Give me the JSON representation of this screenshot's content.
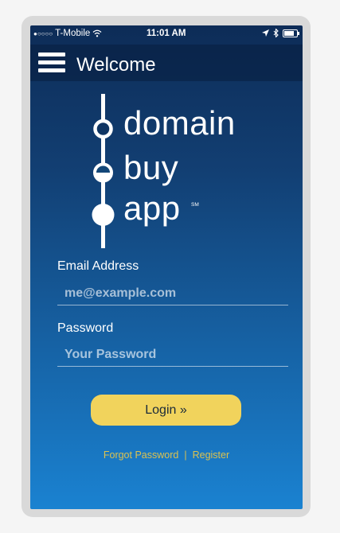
{
  "statusbar": {
    "signal_dots": "●○○○○",
    "carrier": "T-Mobile",
    "time": "11:01 AM"
  },
  "navbar": {
    "menu_icon": "hamburger-menu-icon",
    "title": "Welcome"
  },
  "logo": {
    "line1": "domain",
    "line2": "buy",
    "line3": "app",
    "mark": "SM"
  },
  "form": {
    "email_label": "Email Address",
    "email_placeholder": "me@example.com",
    "password_label": "Password",
    "password_placeholder": "Your Password",
    "login_label": "Login »"
  },
  "links": {
    "forgot": "Forgot Password",
    "separator": "|",
    "register": "Register"
  },
  "colors": {
    "gradient_top": "#0d2c57",
    "gradient_bottom": "#1a82d1",
    "button": "#f1d35c",
    "link": "#dcc24f"
  }
}
